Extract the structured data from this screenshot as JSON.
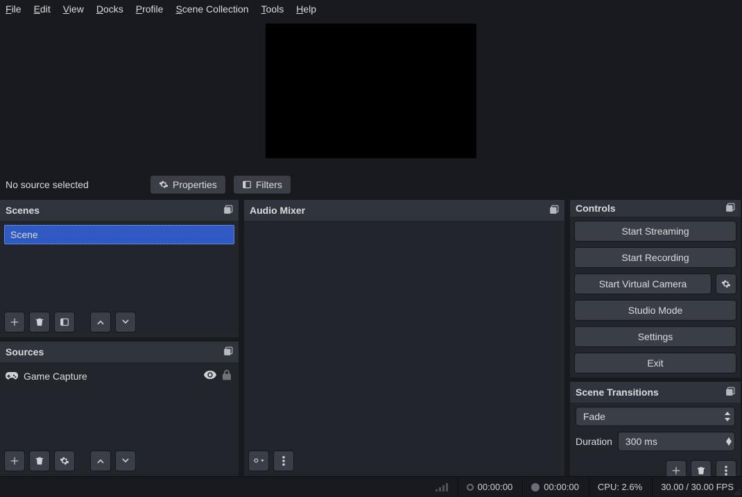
{
  "menu": {
    "file": "File",
    "edit": "Edit",
    "view": "View",
    "docks": "Docks",
    "profile": "Profile",
    "scene_collection": "Scene Collection",
    "tools": "Tools",
    "help": "Help"
  },
  "toolbar": {
    "no_source_label": "No source selected",
    "properties": "Properties",
    "filters": "Filters"
  },
  "panels": {
    "scenes_title": "Scenes",
    "sources_title": "Sources",
    "audio_mixer_title": "Audio Mixer",
    "controls_title": "Controls",
    "transitions_title": "Scene Transitions"
  },
  "scenes": {
    "items": [
      "Scene"
    ]
  },
  "sources": {
    "items": [
      {
        "name": "Game Capture",
        "visible": true,
        "locked": false
      }
    ]
  },
  "controls": {
    "start_streaming": "Start Streaming",
    "start_recording": "Start Recording",
    "start_virtual_camera": "Start Virtual Camera",
    "studio_mode": "Studio Mode",
    "settings": "Settings",
    "exit": "Exit"
  },
  "transitions": {
    "selected": "Fade",
    "duration_label": "Duration",
    "duration_value": "300 ms"
  },
  "status": {
    "stream_time": "00:00:00",
    "record_time": "00:00:00",
    "cpu": "CPU: 2.6%",
    "fps": "30.00 / 30.00 FPS"
  }
}
